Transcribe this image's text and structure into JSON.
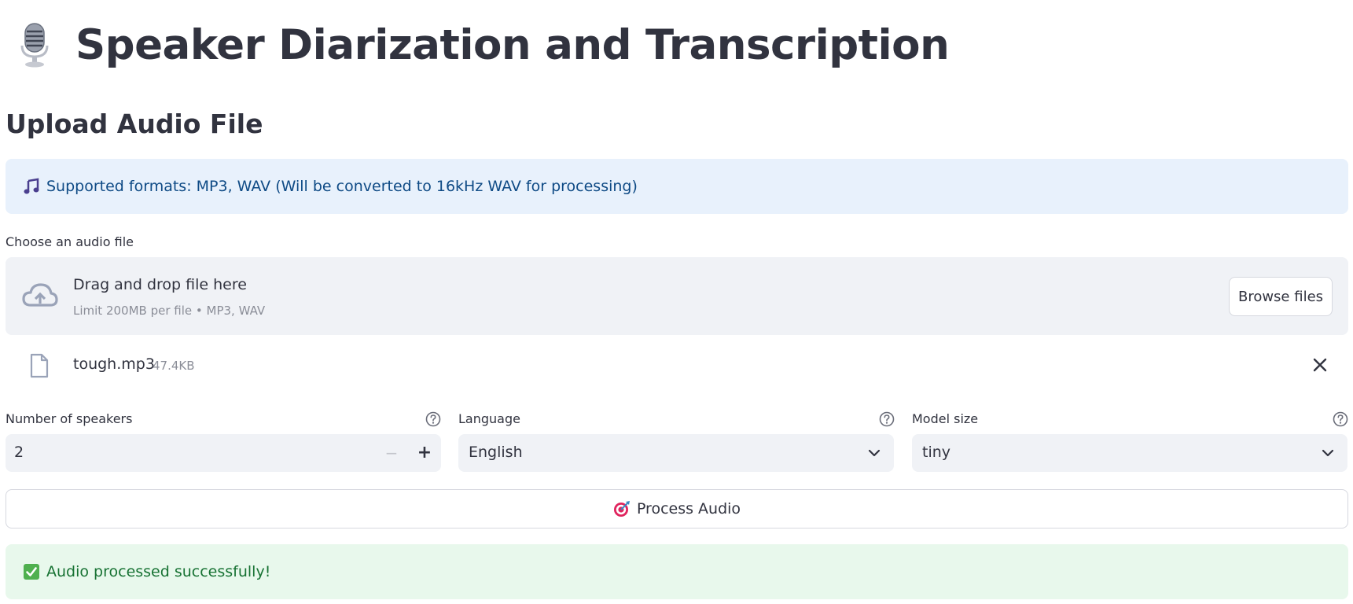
{
  "header": {
    "title": "Speaker Diarization and Transcription",
    "icon": "microphone-icon"
  },
  "upload": {
    "subheader": "Upload Audio File",
    "info": {
      "icon": "musical-note-icon",
      "text": "Supported formats: MP3, WAV (Will be converted to 16kHz WAV for processing)"
    },
    "uploader_label": "Choose an audio file",
    "dropzone": {
      "title": "Drag and drop file here",
      "subtitle": "Limit 200MB per file • MP3, WAV",
      "browse_label": "Browse files"
    },
    "file": {
      "name": "tough.mp3",
      "size": "47.4KB"
    }
  },
  "settings": {
    "speakers": {
      "label": "Number of speakers",
      "value": "2"
    },
    "language": {
      "label": "Language",
      "value": "English"
    },
    "model": {
      "label": "Model size",
      "value": "tiny"
    }
  },
  "actions": {
    "process_label": "Process Audio",
    "process_icon": "direct-hit-target-icon"
  },
  "status": {
    "success_text": "Audio processed successfully!",
    "success_icon": "check-mark-icon"
  },
  "colors": {
    "info_bg": "#e8f1fc",
    "info_text": "#0e4a85",
    "success_bg": "#e8f8ec",
    "success_text": "#177233",
    "input_bg": "#f0f2f6",
    "text": "#31333f"
  }
}
